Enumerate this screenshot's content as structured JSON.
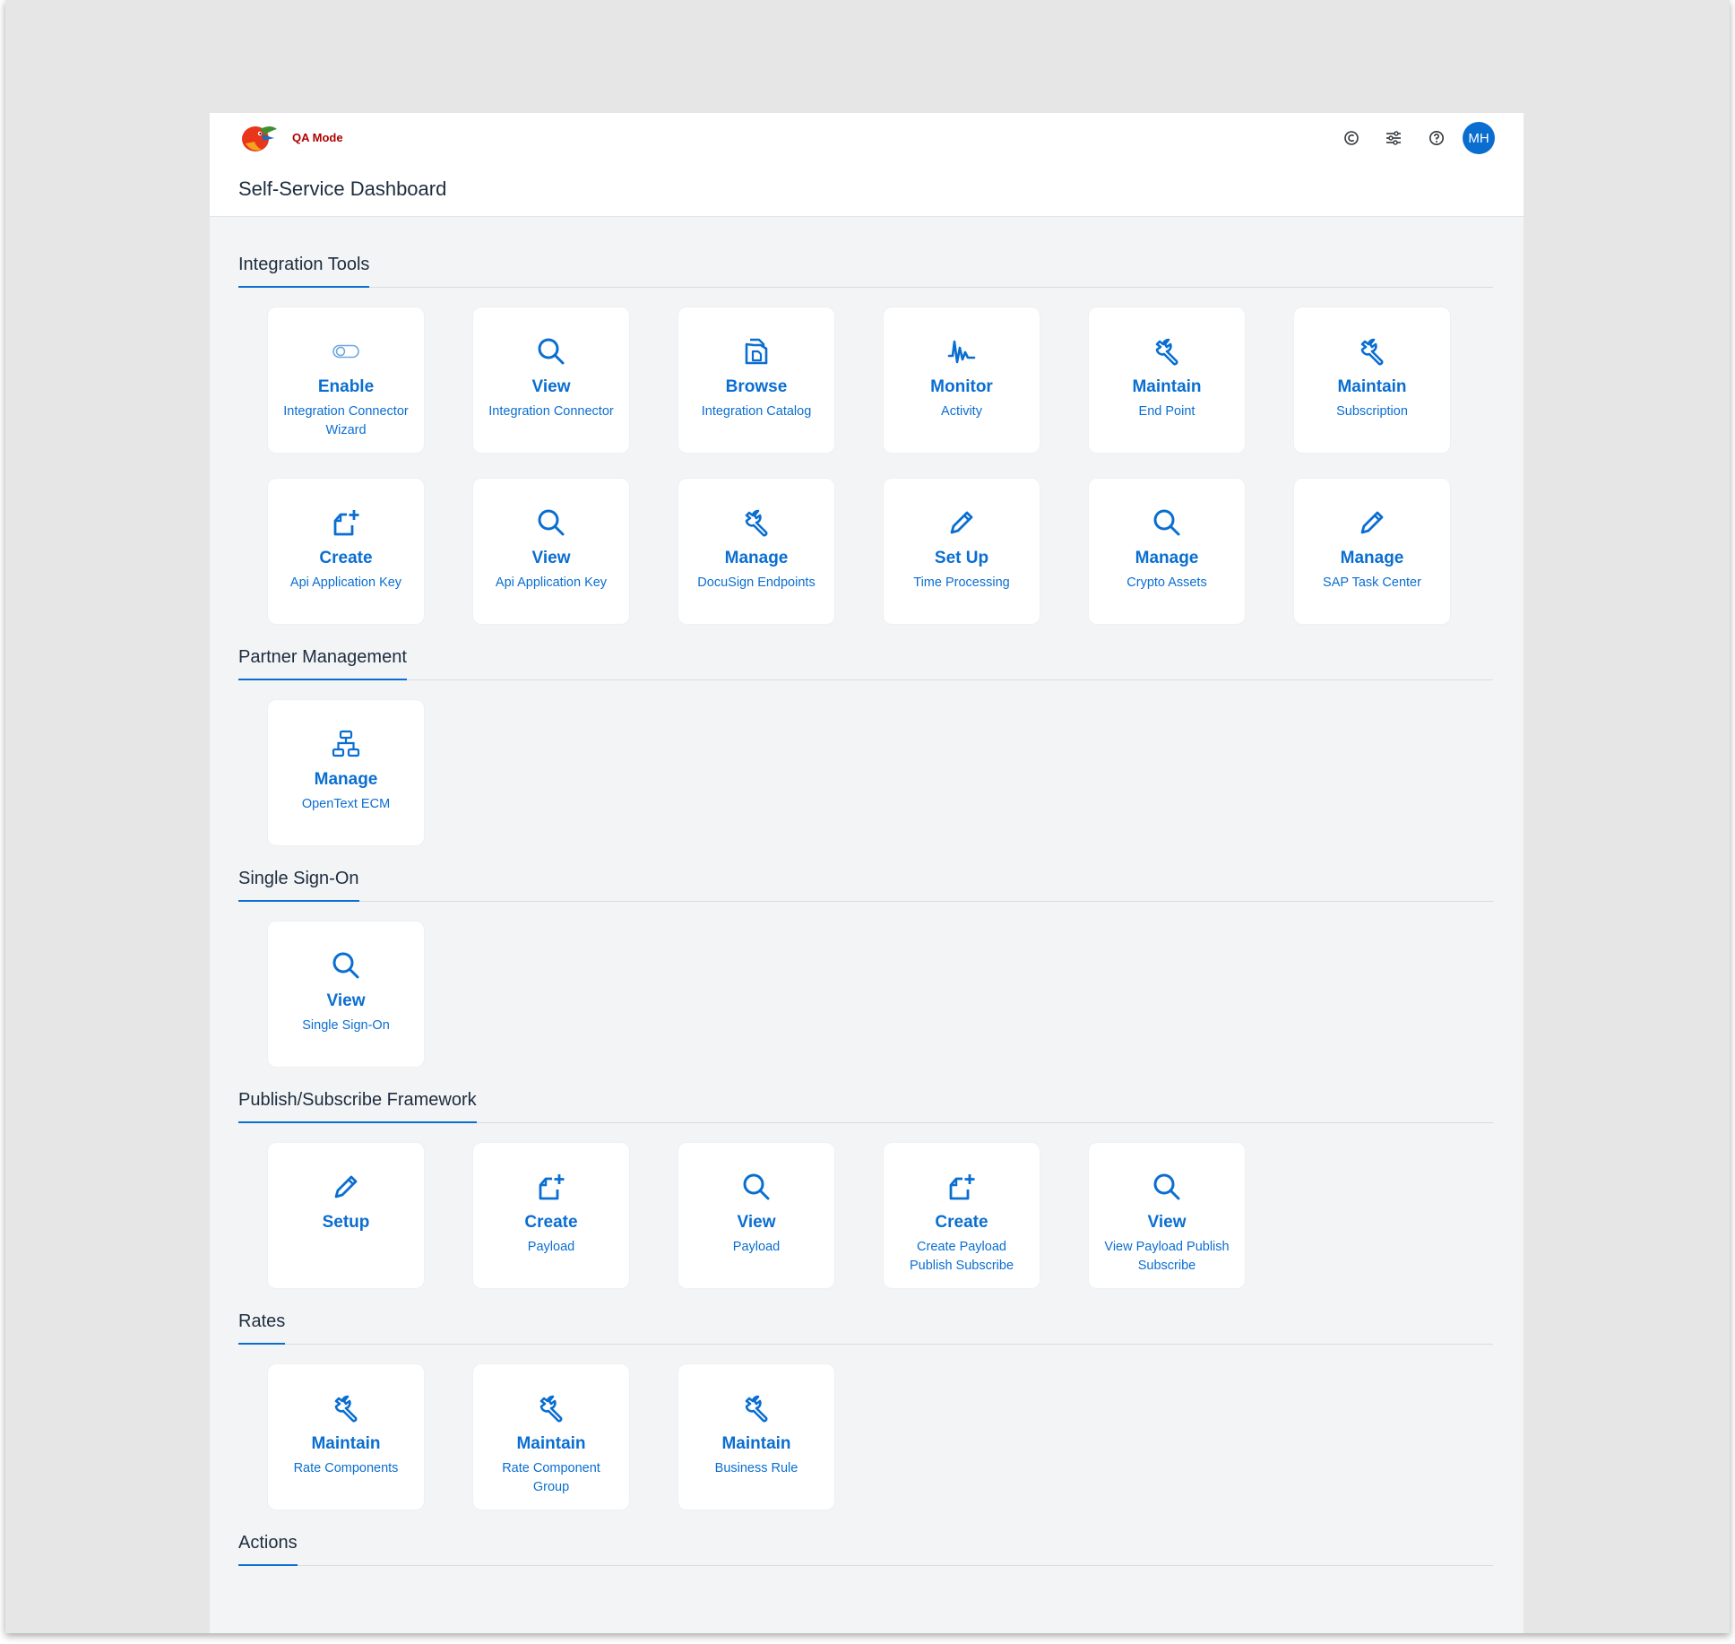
{
  "header": {
    "mode_label": "QA Mode",
    "page_title": "Self-Service Dashboard",
    "avatar_initials": "MH",
    "icons": [
      "copyright-icon",
      "settings-sliders-icon",
      "help-icon"
    ]
  },
  "colors": {
    "accent": "#0a6ed1",
    "mode_text": "#b00000",
    "background": "#f3f4f6",
    "tile": "#ffffff"
  },
  "sections": [
    {
      "title": "Integration Tools",
      "tiles": [
        {
          "title": "Enable",
          "subtitle": "Integration Connector Wizard",
          "icon": "toggle-icon"
        },
        {
          "title": "View",
          "subtitle": "Integration Connector",
          "icon": "search-icon"
        },
        {
          "title": "Browse",
          "subtitle": "Integration Catalog",
          "icon": "documents-icon"
        },
        {
          "title": "Monitor",
          "subtitle": "Activity",
          "icon": "activity-icon"
        },
        {
          "title": "Maintain",
          "subtitle": "End Point",
          "icon": "wrench-icon"
        },
        {
          "title": "Maintain",
          "subtitle": "Subscription",
          "icon": "wrench-icon"
        },
        {
          "title": "Create",
          "subtitle": "Api Application Key",
          "icon": "add-document-icon"
        },
        {
          "title": "View",
          "subtitle": "Api Application Key",
          "icon": "search-icon"
        },
        {
          "title": "Manage",
          "subtitle": "DocuSign Endpoints",
          "icon": "wrench-icon"
        },
        {
          "title": "Set Up",
          "subtitle": "Time Processing",
          "icon": "pencil-icon"
        },
        {
          "title": "Manage",
          "subtitle": "Crypto Assets",
          "icon": "search-icon"
        },
        {
          "title": "Manage",
          "subtitle": "SAP Task Center",
          "icon": "pencil-icon"
        }
      ]
    },
    {
      "title": "Partner Management",
      "tiles": [
        {
          "title": "Manage",
          "subtitle": "OpenText ECM",
          "icon": "hierarchy-icon"
        }
      ]
    },
    {
      "title": "Single Sign-On",
      "tiles": [
        {
          "title": "View",
          "subtitle": "Single Sign-On",
          "icon": "search-icon"
        }
      ]
    },
    {
      "title": "Publish/Subscribe Framework",
      "tiles": [
        {
          "title": "Setup",
          "subtitle": "",
          "icon": "pencil-icon"
        },
        {
          "title": "Create",
          "subtitle": "Payload",
          "icon": "add-document-icon"
        },
        {
          "title": "View",
          "subtitle": "Payload",
          "icon": "search-icon"
        },
        {
          "title": "Create",
          "subtitle": "Create Payload Publish Subscribe",
          "icon": "add-document-icon"
        },
        {
          "title": "View",
          "subtitle": "View Payload Publish Subscribe",
          "icon": "search-icon"
        }
      ]
    },
    {
      "title": "Rates",
      "tiles": [
        {
          "title": "Maintain",
          "subtitle": "Rate Components",
          "icon": "wrench-icon"
        },
        {
          "title": "Maintain",
          "subtitle": "Rate Component Group",
          "icon": "wrench-icon"
        },
        {
          "title": "Maintain",
          "subtitle": "Business Rule",
          "icon": "wrench-icon"
        }
      ]
    },
    {
      "title": "Actions",
      "tiles": []
    }
  ]
}
